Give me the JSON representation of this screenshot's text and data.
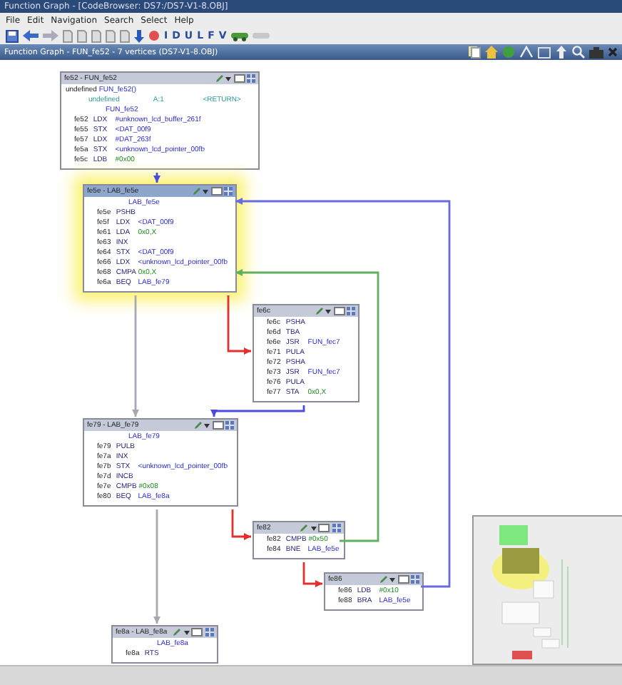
{
  "window": {
    "title": "Function Graph - [CodeBrowser: DS7:/DS7-V1-8.OBJ]"
  },
  "menu": [
    "File",
    "Edit",
    "Navigation",
    "Search",
    "Select",
    "Help"
  ],
  "toolbar": {
    "letter_buttons": [
      "I",
      "D",
      "U",
      "L",
      "F",
      "V"
    ]
  },
  "panel": {
    "title": "Function Graph - FUN_fe52 - 7 vertices  (DS7-V1-8.OBJ)"
  },
  "nodes": [
    {
      "title": "fe52 - FUN_fe52",
      "selected": false,
      "lines": [
        {
          "kind": "signature",
          "type": "undefined",
          "name": "FUN_fe52()"
        },
        {
          "kind": "param",
          "type": "undefined",
          "storage": "A:1",
          "name": "<RETURN>"
        },
        {
          "kind": "label",
          "text": "FUN_fe52"
        },
        {
          "kind": "insn_ref",
          "address": "fe52",
          "mnemonic": "LDX",
          "operand": "#unknown_lcd_buffer_261f"
        },
        {
          "kind": "insn_ref",
          "address": "fe55",
          "mnemonic": "STX",
          "operand": "<DAT_00f9"
        },
        {
          "kind": "insn_ref",
          "address": "fe57",
          "mnemonic": "LDX",
          "operand": "#DAT_263f"
        },
        {
          "kind": "insn_ref",
          "address": "fe5a",
          "mnemonic": "STX",
          "operand": "<unknown_lcd_pointer_00fb"
        },
        {
          "kind": "insn_imm",
          "address": "fe5c",
          "mnemonic": "LDB",
          "operand": "#0x00"
        }
      ]
    },
    {
      "title": "fe5e - LAB_fe5e",
      "selected": true,
      "lines": [
        {
          "kind": "label",
          "text": "LAB_fe5e"
        },
        {
          "kind": "insn",
          "address": "fe5e",
          "mnemonic": "PSHB"
        },
        {
          "kind": "insn_ref",
          "address": "fe5f",
          "mnemonic": "LDX",
          "operand": "<DAT_00f9"
        },
        {
          "kind": "insn_imm",
          "address": "fe61",
          "mnemonic": "LDA",
          "operand": "0x0,X"
        },
        {
          "kind": "insn",
          "address": "fe63",
          "mnemonic": "INX"
        },
        {
          "kind": "insn_ref",
          "address": "fe64",
          "mnemonic": "STX",
          "operand": "<DAT_00f9"
        },
        {
          "kind": "insn_ref",
          "address": "fe66",
          "mnemonic": "LDX",
          "operand": "<unknown_lcd_pointer_00fb"
        },
        {
          "kind": "insn_imm",
          "address": "fe68",
          "mnemonic": "CMPA",
          "operand": "0x0,X"
        },
        {
          "kind": "insn_ref",
          "address": "fe6a",
          "mnemonic": "BEQ",
          "operand": "LAB_fe79"
        }
      ]
    },
    {
      "title": "fe6c",
      "selected": false,
      "lines": [
        {
          "kind": "insn",
          "address": "fe6c",
          "mnemonic": "PSHA"
        },
        {
          "kind": "insn",
          "address": "fe6d",
          "mnemonic": "TBA"
        },
        {
          "kind": "insn_ref",
          "address": "fe6e",
          "mnemonic": "JSR",
          "operand": "FUN_fec7"
        },
        {
          "kind": "insn",
          "address": "fe71",
          "mnemonic": "PULA"
        },
        {
          "kind": "insn",
          "address": "fe72",
          "mnemonic": "PSHA"
        },
        {
          "kind": "insn_ref",
          "address": "fe73",
          "mnemonic": "JSR",
          "operand": "FUN_fec7"
        },
        {
          "kind": "insn",
          "address": "fe76",
          "mnemonic": "PULA"
        },
        {
          "kind": "insn_imm",
          "address": "fe77",
          "mnemonic": "STA",
          "operand": "0x0,X"
        }
      ]
    },
    {
      "title": "fe79 - LAB_fe79",
      "selected": false,
      "lines": [
        {
          "kind": "label",
          "text": "LAB_fe79"
        },
        {
          "kind": "insn",
          "address": "fe79",
          "mnemonic": "PULB"
        },
        {
          "kind": "insn",
          "address": "fe7a",
          "mnemonic": "INX"
        },
        {
          "kind": "insn_ref",
          "address": "fe7b",
          "mnemonic": "STX",
          "operand": "<unknown_lcd_pointer_00fb"
        },
        {
          "kind": "insn",
          "address": "fe7d",
          "mnemonic": "INCB"
        },
        {
          "kind": "insn_imm",
          "address": "fe7e",
          "mnemonic": "CMPB",
          "operand": "#0x08"
        },
        {
          "kind": "insn_ref",
          "address": "fe80",
          "mnemonic": "BEQ",
          "operand": "LAB_fe8a"
        }
      ]
    },
    {
      "title": "fe82",
      "selected": false,
      "lines": [
        {
          "kind": "insn_imm",
          "address": "fe82",
          "mnemonic": "CMPB",
          "operand": "#0x50"
        },
        {
          "kind": "insn_ref",
          "address": "fe84",
          "mnemonic": "BNE",
          "operand": "LAB_fe5e"
        }
      ]
    },
    {
      "title": "fe86",
      "selected": false,
      "lines": [
        {
          "kind": "insn_imm",
          "address": "fe86",
          "mnemonic": "LDB",
          "operand": "#0x10"
        },
        {
          "kind": "insn_ref",
          "address": "fe88",
          "mnemonic": "BRA",
          "operand": "LAB_fe5e"
        }
      ]
    },
    {
      "title": "fe8a - LAB_fe8a",
      "selected": false,
      "lines": [
        {
          "kind": "label",
          "text": "LAB_fe8a"
        },
        {
          "kind": "insn",
          "address": "fe8a",
          "mnemonic": "RTS"
        }
      ]
    }
  ],
  "edges": [
    {
      "color": "#4a4adc"
    },
    {
      "color": "#e03030"
    },
    {
      "color": "#a8a8b0"
    },
    {
      "color": "#4a4adc"
    },
    {
      "color": "#e03030"
    },
    {
      "color": "#a8a8b0"
    },
    {
      "color": "#60b060"
    },
    {
      "color": "#e03030"
    },
    {
      "color": "#6a6ae0"
    }
  ]
}
